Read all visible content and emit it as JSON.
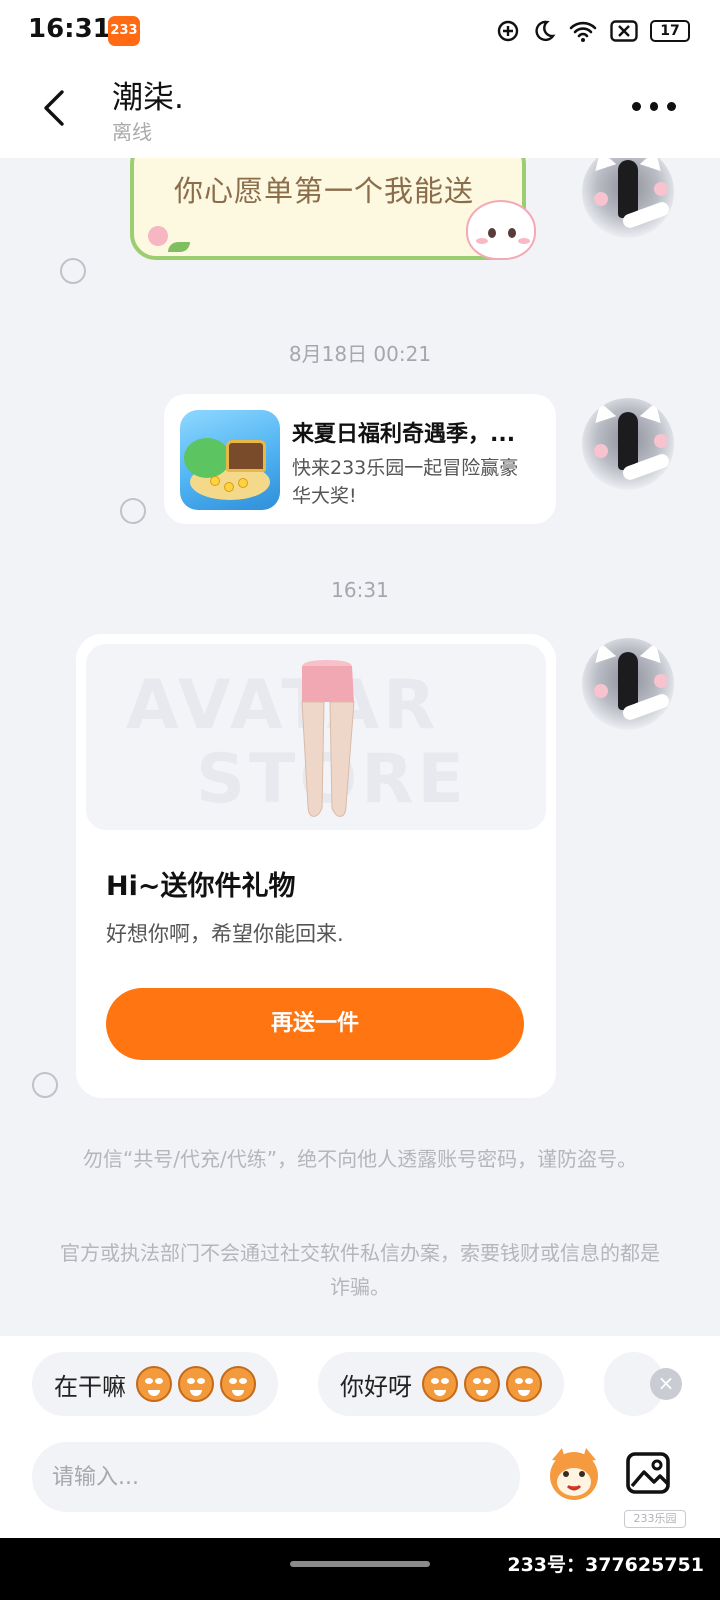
{
  "status_bar": {
    "time": "16:31",
    "app_badge": "233",
    "battery": "17"
  },
  "header": {
    "name": "潮柒.",
    "status": "离线"
  },
  "messages": {
    "wish_sticker_text": "你心愿单第一个我能送",
    "time_1": "8月18日 00:21",
    "link_card": {
      "title": "来夏日福利奇遇季，...",
      "description": "快来233乐园一起冒险赢豪华大奖!"
    },
    "time_2": "16:31",
    "gift_card": {
      "watermark_line1": "AVATAR",
      "watermark_line2": "STORE",
      "title": "Hi~送你件礼物",
      "description": "好想你啊，希望你能回来.",
      "button_label": "再送一件"
    },
    "notice_1": "勿信“共号/代充/代练”，绝不向他人透露账号密码，谨防盗号。",
    "notice_2": "官方或执法部门不会通过社交软件私信办案，索要钱财或信息的都是诈骗。"
  },
  "quick_replies": [
    {
      "text": "在干嘛"
    },
    {
      "text": "你好呀"
    }
  ],
  "input": {
    "placeholder": "请输入..."
  },
  "brand_mark": "233乐园",
  "account_watermark": "233号：377625751",
  "colors": {
    "accent": "#ff7512",
    "background": "#f2f3f7"
  }
}
